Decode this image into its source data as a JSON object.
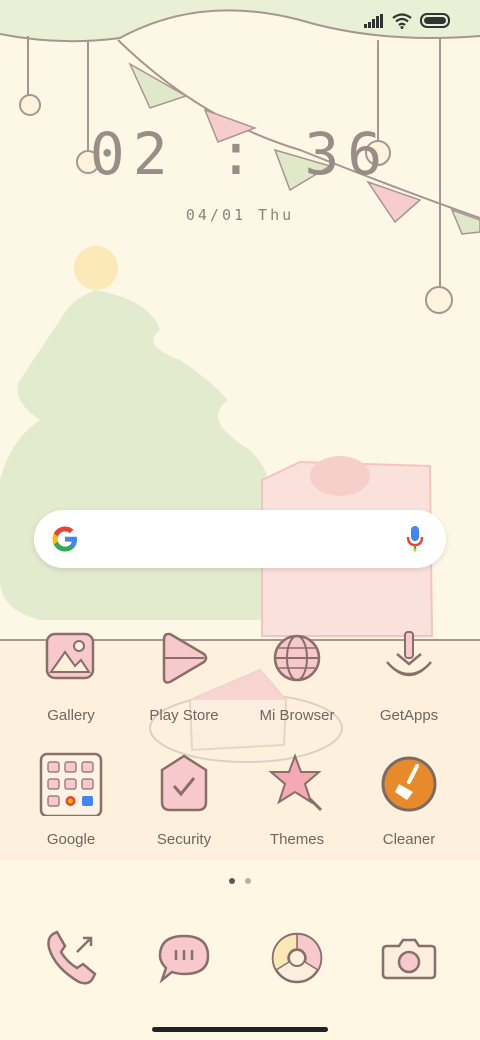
{
  "status_bar": {
    "signal_icon": "signal-icon",
    "wifi_icon": "wifi-icon",
    "battery_icon": "battery-icon"
  },
  "clock": {
    "time": "02:36",
    "date": "04/01 Thu"
  },
  "search": {
    "logo_icon": "google-g-icon",
    "mic_icon": "microphone-icon"
  },
  "apps": [
    {
      "label": "Gallery",
      "icon": "gallery-icon"
    },
    {
      "label": "Play Store",
      "icon": "play-store-icon"
    },
    {
      "label": "Mi Browser",
      "icon": "browser-icon"
    },
    {
      "label": "GetApps",
      "icon": "getapps-icon"
    },
    {
      "label": "Google",
      "icon": "google-folder-icon"
    },
    {
      "label": "Security",
      "icon": "security-icon"
    },
    {
      "label": "Themes",
      "icon": "themes-icon"
    },
    {
      "label": "Cleaner",
      "icon": "cleaner-icon"
    }
  ],
  "page_indicator": {
    "pages": 2,
    "current": 1
  },
  "dock": [
    {
      "icon": "phone-icon"
    },
    {
      "icon": "messages-icon"
    },
    {
      "icon": "chrome-browser-icon"
    },
    {
      "icon": "camera-icon"
    }
  ],
  "colors": {
    "background": "#fdf7e4",
    "icon_pink": "#f4b8bf",
    "icon_outline": "#8a6e6a",
    "cleaner_orange": "#e68a2a",
    "label": "#6f6661"
  }
}
